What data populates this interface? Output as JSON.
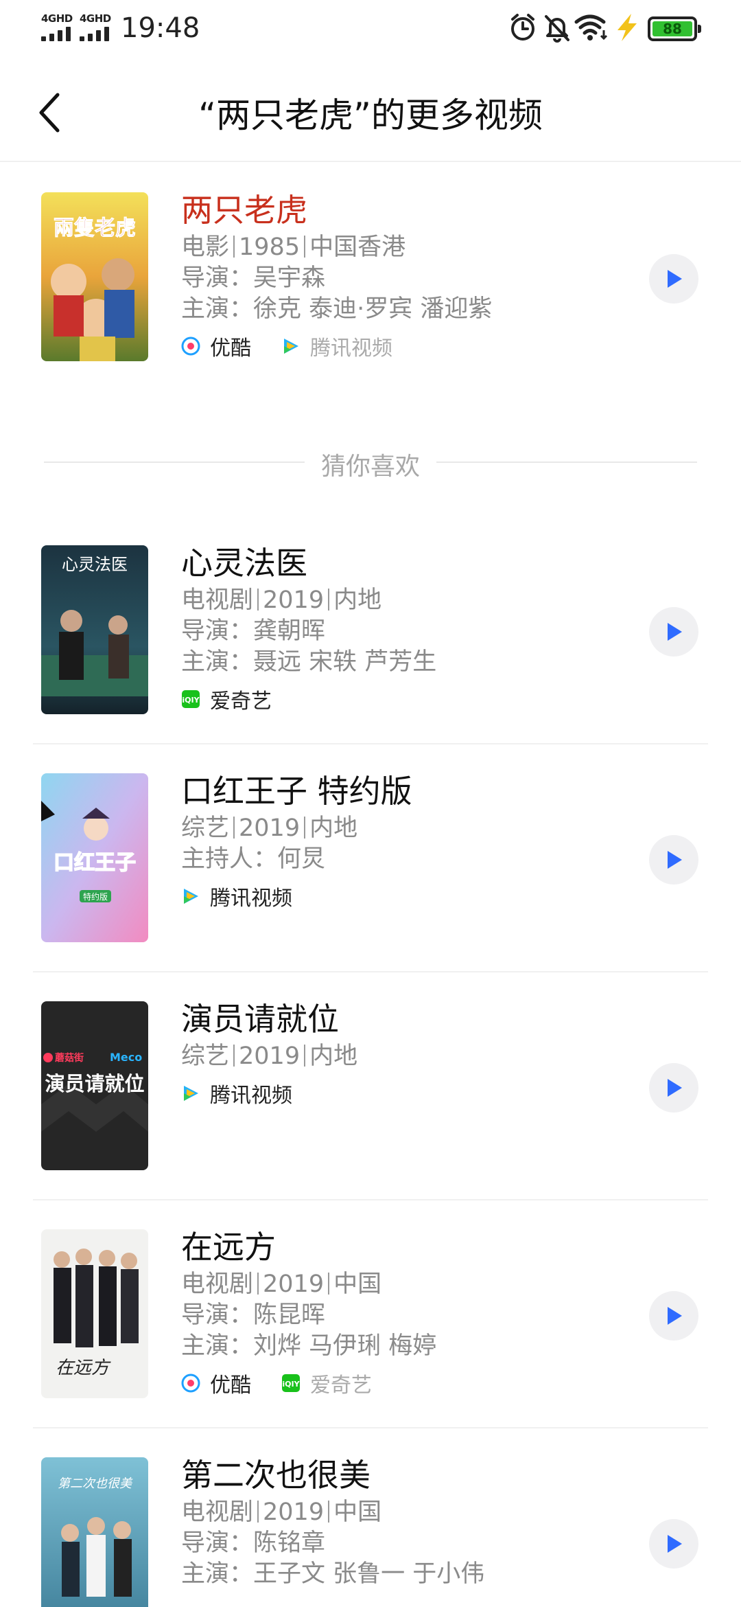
{
  "status_bar": {
    "network_1": "4GHD",
    "network_2": "4GHD",
    "time": "19:48",
    "battery": "88",
    "colors": {
      "battery_fill": "#31c031"
    }
  },
  "header": {
    "title": "“两只老虎”的更多视频"
  },
  "main_result": {
    "title": "两只老虎",
    "genre": "电影",
    "year": "1985",
    "region": "中国香港",
    "director_label": "导演：",
    "director": "吴宇森",
    "cast_label": "主演：",
    "cast": "徐克 泰迪·罗宾 潘迎紫",
    "sources": [
      {
        "name": "优酷",
        "icon": "youku-icon",
        "active": true
      },
      {
        "name": "腾讯视频",
        "icon": "tencent-video-icon",
        "active": false
      }
    ]
  },
  "section_label": "猜你喜欢",
  "recommendations": [
    {
      "title": "心灵法医",
      "genre": "电视剧",
      "year": "2019",
      "region": "内地",
      "lines": [
        {
          "label": "导演：",
          "value": "龚朝晖"
        },
        {
          "label": "主演：",
          "value": "聂远 宋轶 芦芳生"
        }
      ],
      "sources": [
        {
          "name": "爱奇艺",
          "icon": "iqiyi-icon",
          "active": true
        }
      ]
    },
    {
      "title": "口红王子 特约版",
      "genre": "综艺",
      "year": "2019",
      "region": "内地",
      "lines": [
        {
          "label": "主持人：",
          "value": "何炅"
        }
      ],
      "sources": [
        {
          "name": "腾讯视频",
          "icon": "tencent-video-icon",
          "active": true
        }
      ]
    },
    {
      "title": "演员请就位",
      "genre": "综艺",
      "year": "2019",
      "region": "内地",
      "lines": [],
      "sources": [
        {
          "name": "腾讯视频",
          "icon": "tencent-video-icon",
          "active": true
        }
      ]
    },
    {
      "title": "在远方",
      "genre": "电视剧",
      "year": "2019",
      "region": "中国",
      "lines": [
        {
          "label": "导演：",
          "value": "陈昆晖"
        },
        {
          "label": "主演：",
          "value": "刘烨 马伊琍 梅婷"
        }
      ],
      "sources": [
        {
          "name": "优酷",
          "icon": "youku-icon",
          "active": true
        },
        {
          "name": "爱奇艺",
          "icon": "iqiyi-icon",
          "active": false
        }
      ]
    },
    {
      "title": "第二次也很美",
      "genre": "电视剧",
      "year": "2019",
      "region": "中国",
      "lines": [
        {
          "label": "导演：",
          "value": "陈铭章"
        },
        {
          "label": "主演：",
          "value": "王子文 张鲁一 于小伟"
        }
      ],
      "sources": []
    }
  ],
  "posters": {
    "poster_1_text": "兩隻老虎",
    "poster_2_text": "心灵法医",
    "poster_3_text": "口红王子",
    "poster_3_badge": "特约版",
    "poster_4_brand_1": "蘑菇街",
    "poster_4_brand_2": "Meco",
    "poster_4_text": "演员请就位",
    "poster_5_text": "在远方",
    "poster_6_text": "第二次也很美"
  }
}
